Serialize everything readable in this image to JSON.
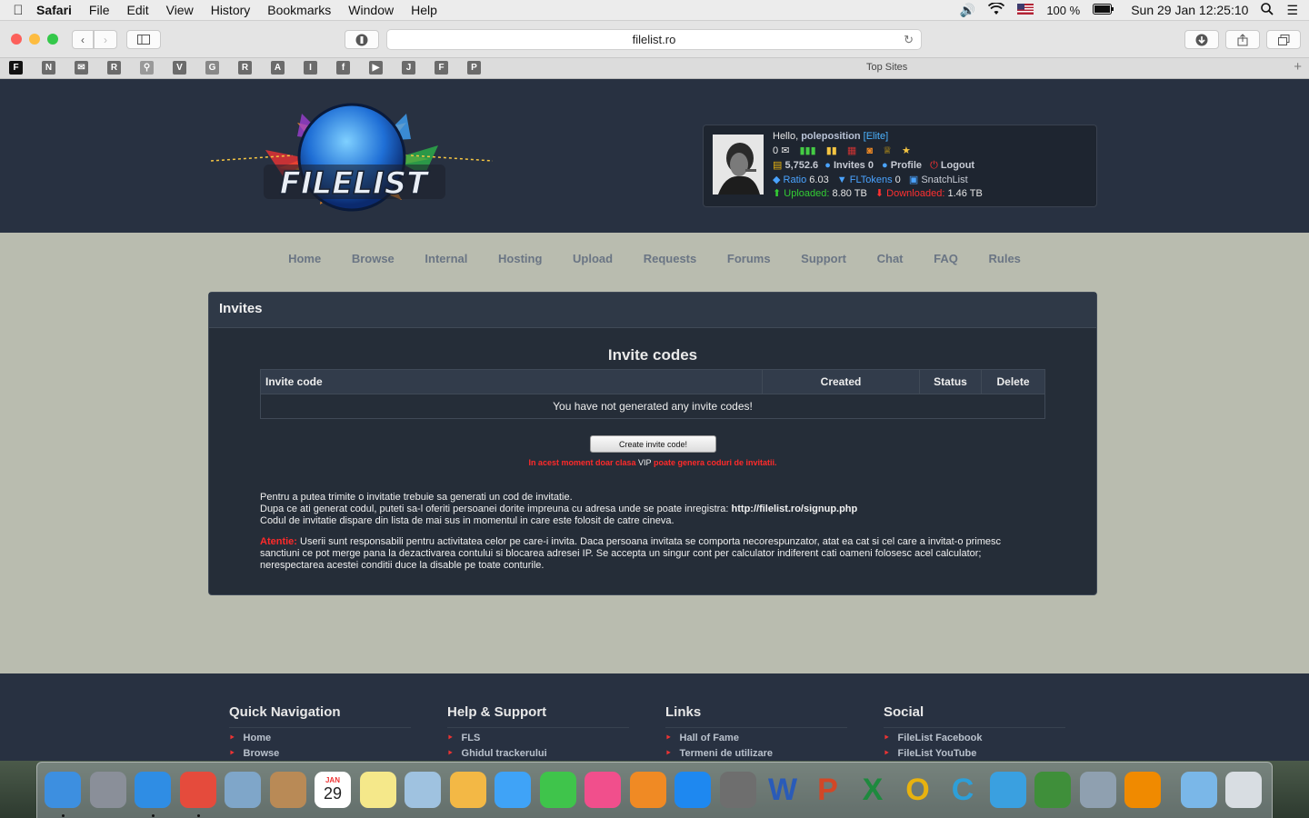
{
  "menubar": {
    "app": "Safari",
    "items": [
      "File",
      "Edit",
      "View",
      "History",
      "Bookmarks",
      "Window",
      "Help"
    ],
    "battery": "100 %",
    "clock": "Sun 29 Jan  12:25:10"
  },
  "browser": {
    "url": "filelist.ro",
    "favorites": [
      "F",
      "N",
      "✉",
      "R",
      "⚲",
      "V",
      "G",
      "R",
      "A",
      "I",
      "f",
      "▶",
      "J",
      "F",
      "P"
    ],
    "top_sites": "Top Sites",
    "colors": {
      "close": "#fc605b",
      "minimize": "#fdbc40",
      "maximize": "#34c84a"
    }
  },
  "user": {
    "hello": "Hello,",
    "username": "poleposition",
    "class": "[Elite]",
    "messages": "0",
    "bonus": "5,752.6",
    "invites_label": "Invites 0",
    "profile": "Profile",
    "logout": "Logout",
    "ratio_label": "Ratio",
    "ratio": "6.03",
    "fltokens_label": "FLTokens",
    "fltokens": "0",
    "snatchlist": "SnatchList",
    "uploaded_label": "Uploaded:",
    "uploaded": "8.80 TB",
    "downloaded_label": "Downloaded:",
    "downloaded": "1.46 TB"
  },
  "logo_text": "FILELIST",
  "nav": [
    "Home",
    "Browse",
    "Internal",
    "Hosting",
    "Upload",
    "Requests",
    "Forums",
    "Support",
    "Chat",
    "FAQ",
    "Rules"
  ],
  "panel": {
    "title": "Invites",
    "subtitle": "Invite codes",
    "columns": [
      "Invite code",
      "Created",
      "Status",
      "Delete"
    ],
    "empty": "You have not generated any invite codes!",
    "create_button": "Create invite code!",
    "warning_a": "In acest moment doar clasa",
    "warning_vip": "VIP",
    "warning_b": "poate genera coduri de invitatii.",
    "info1": "Pentru a putea trimite o invitatie trebuie sa generati un cod de invitatie.",
    "info2": "Dupa ce ati generat codul, puteti sa-l oferiti persoanei dorite impreuna cu adresa unde se poate inregistra:",
    "signup_url": "http://filelist.ro/signup.php",
    "info3": "Codul de invitatie dispare din lista de mai sus in momentul in care este folosit de catre cineva.",
    "attention_label": "Atentie:",
    "attention_text": "Userii sunt responsabili pentru activitatea celor pe care-i invita. Daca persoana invitata se comporta necorespunzator, atat ea cat si cel care a invitat-o primesc sanctiuni ce pot merge pana la dezactivarea contului si blocarea adresei IP. Se accepta un singur cont per calculator indiferent cati oameni folosesc acel calculator; nerespectarea acestei conditii duce la disable pe toate conturile."
  },
  "footer": {
    "quick_nav": {
      "heading": "Quick Navigation",
      "links": [
        "Home",
        "Browse"
      ]
    },
    "help": {
      "heading": "Help & Support",
      "links": [
        "FLS",
        "Ghidul trackerului"
      ]
    },
    "links": {
      "heading": "Links",
      "links": [
        "Hall of Fame",
        "Termeni de utilizare"
      ]
    },
    "social": {
      "heading": "Social",
      "links": [
        "FileList Facebook",
        "FileList YouTube"
      ]
    }
  },
  "dock": {
    "calendar_month": "JAN",
    "calendar_day": "29",
    "apps": [
      {
        "name": "finder-icon",
        "color": "#3d8fe0"
      },
      {
        "name": "launchpad-icon",
        "color": "#8a8f99"
      },
      {
        "name": "safari-icon",
        "color": "#2f8de4"
      },
      {
        "name": "chrome-icon",
        "color": "#e54b3c"
      },
      {
        "name": "preview-icon",
        "color": "#7fa6c9"
      },
      {
        "name": "contacts-icon",
        "color": "#b98a56"
      },
      {
        "name": "calendar-icon",
        "color": "#ffffff"
      },
      {
        "name": "notes-icon",
        "color": "#f5e88a"
      },
      {
        "name": "photo-browser-icon",
        "color": "#9fc2e0"
      },
      {
        "name": "photos-icon",
        "color": "#f3b845"
      },
      {
        "name": "messages-icon",
        "color": "#3fa3f7"
      },
      {
        "name": "facetime-icon",
        "color": "#3fc44b"
      },
      {
        "name": "itunes-icon",
        "color": "#f14f8c"
      },
      {
        "name": "ibooks-icon",
        "color": "#f08a24"
      },
      {
        "name": "app-store-icon",
        "color": "#1e88f0"
      },
      {
        "name": "system-preferences-icon",
        "color": "#6e6e6e"
      },
      {
        "name": "word-icon",
        "color": "#2a5bb8"
      },
      {
        "name": "powerpoint-icon",
        "color": "#d24726"
      },
      {
        "name": "excel-icon",
        "color": "#1e8a3e"
      },
      {
        "name": "outlook-icon",
        "color": "#e8b20f"
      },
      {
        "name": "c-app-icon",
        "color": "#2e9fd8"
      },
      {
        "name": "messenger-icon",
        "color": "#3aa0e0"
      },
      {
        "name": "network-icon",
        "color": "#3f8f3a"
      },
      {
        "name": "satellite-icon",
        "color": "#8fa0b0"
      },
      {
        "name": "vlc-icon",
        "color": "#f08a00"
      },
      {
        "name": "downloads-folder-icon",
        "color": "#7ab7e8"
      },
      {
        "name": "trash-icon",
        "color": "#d8dde2"
      }
    ],
    "letters": {
      "word": "W",
      "powerpoint": "P",
      "excel": "X",
      "outlook": "O",
      "c": "C"
    }
  }
}
